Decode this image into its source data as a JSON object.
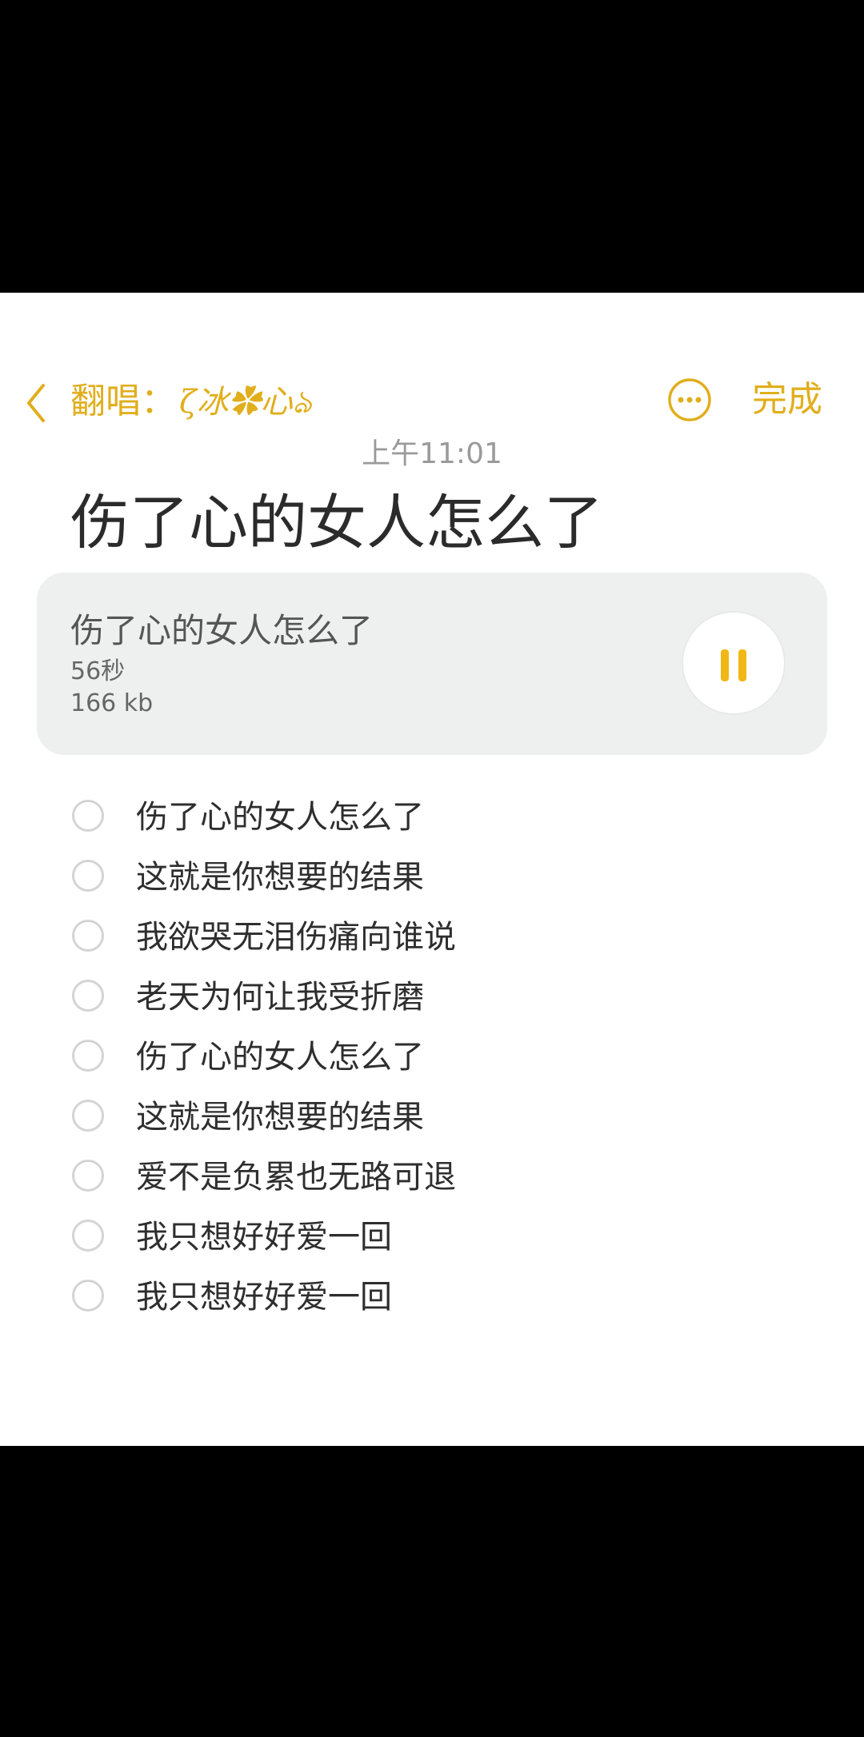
{
  "header": {
    "back_label_prefix": "翻唱：",
    "back_label_name": "ζ冰✿心ঌ",
    "done_label": "完成",
    "accent_color": "#e1ae1c"
  },
  "note": {
    "timestamp": "上午11:01",
    "title": "伤了心的女人怎么了"
  },
  "audio": {
    "name": "伤了心的女人怎么了",
    "duration": "56秒",
    "size": "166 kb",
    "state": "playing",
    "control_icon": "pause-icon"
  },
  "checklist": [
    {
      "text": "伤了心的女人怎么了",
      "checked": false
    },
    {
      "text": "这就是你想要的结果",
      "checked": false
    },
    {
      "text": "我欲哭无泪伤痛向谁说",
      "checked": false
    },
    {
      "text": "老天为何让我受折磨",
      "checked": false
    },
    {
      "text": "伤了心的女人怎么了",
      "checked": false
    },
    {
      "text": "这就是你想要的结果",
      "checked": false
    },
    {
      "text": "爱不是负累也无路可退",
      "checked": false
    },
    {
      "text": "我只想好好爱一回",
      "checked": false
    },
    {
      "text": "我只想好好爱一回",
      "checked": false
    }
  ]
}
